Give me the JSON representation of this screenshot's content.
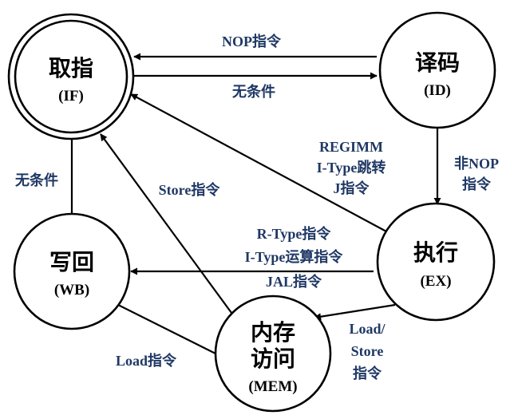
{
  "diagram": {
    "colors": {
      "node_stroke": "#000000",
      "edge": "#000000",
      "label_text": "#1f3864"
    },
    "nodes": {
      "if": {
        "name": "取指",
        "abbr": "(IF)"
      },
      "id": {
        "name": "译码",
        "abbr": "(ID)"
      },
      "ex": {
        "name": "执行",
        "abbr": "(EX)"
      },
      "wb": {
        "name": "写回",
        "abbr": "(WB)"
      },
      "mem": {
        "name_line1": "内存",
        "name_line2": "访问",
        "abbr": "(MEM)"
      }
    },
    "edges": {
      "id_to_if_nop": "NOP指令",
      "if_to_id": "无条件",
      "id_to_ex": [
        "非NOP",
        "指令"
      ],
      "ex_to_if_branch": [
        "REGIMM",
        "I-Type跳转",
        "J指令"
      ],
      "ex_to_wb": [
        "R-Type指令",
        "I-Type运算指令",
        "JAL指令"
      ],
      "ex_to_mem": [
        "Load/",
        "Store",
        "指令"
      ],
      "mem_to_if_store": "Store指令",
      "mem_to_wb_load": "Load指令",
      "wb_to_if": "无条件"
    }
  }
}
